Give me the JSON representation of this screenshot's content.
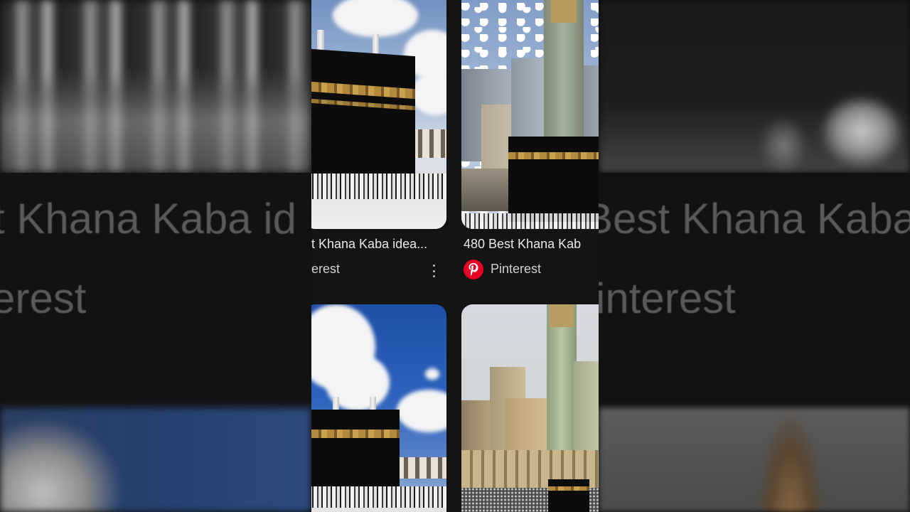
{
  "background": {
    "left_text_title": "t Khana Kaba id",
    "left_text_source": "erest",
    "right_text_title": "Best Khana Kaba",
    "right_text_source": "interest"
  },
  "results": [
    {
      "title": "t Khana Kaba idea...",
      "source": "erest",
      "has_more_menu": true
    },
    {
      "title": "480 Best Khana Kab",
      "source": "Pinterest",
      "source_icon": "pinterest-icon"
    }
  ],
  "colors": {
    "pinterest_red": "#e60023",
    "background": "#141414",
    "text": "#e8e8e8"
  }
}
